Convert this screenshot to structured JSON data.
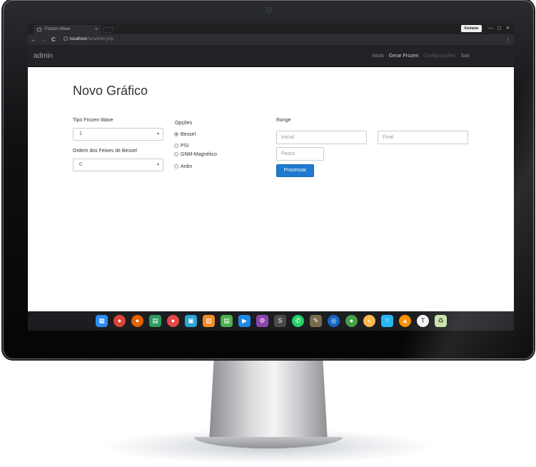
{
  "browser": {
    "tab_title": "Frozen Wave",
    "tab_close": "×",
    "visitor_label": "Visitante",
    "window_buttons": [
      "—",
      "◻",
      "✕"
    ],
    "nav_back": "←",
    "nav_forward": "→",
    "nav_reload": "C",
    "url_host": "localhost",
    "url_path": "/fw/admin.php",
    "menu": "⋮"
  },
  "navbar": {
    "brand": "admin",
    "links": [
      {
        "label": "Inicio",
        "state": "normal"
      },
      {
        "label": "Gerar Frozen",
        "state": "active"
      },
      {
        "label": "Configurações",
        "state": "disabled"
      },
      {
        "label": "Sair",
        "state": "normal"
      }
    ]
  },
  "form": {
    "title": "Novo Gráfico",
    "tipo_label": "Tipo Frozen Wave",
    "tipo_value": "1",
    "ordem_label": "Ordem dos Feixes de Bessel",
    "ordem_value": "0",
    "caret": "▼",
    "opcoes_label": "Opções",
    "options": [
      {
        "label": "Bessel",
        "checked": true
      },
      {
        "label": "PSI",
        "checked": false
      },
      {
        "label": "GNM-Magnético",
        "checked": false
      },
      {
        "label": "Anbn",
        "checked": false
      }
    ],
    "range_label": "Range",
    "inicial_placeholder": "Inicial",
    "final_placeholder": "Final",
    "passo_placeholder": "Passo",
    "submit_label": "Processar"
  },
  "dock": {
    "apps": [
      {
        "icon": "app-grid-icon",
        "color": "#2d8cf0"
      },
      {
        "icon": "chrome-icon",
        "color": "#db4437"
      },
      {
        "icon": "firefox-icon",
        "color": "#e66000"
      },
      {
        "icon": "terminal-icon",
        "color": "#2e9b5f"
      },
      {
        "icon": "record-icon",
        "color": "#e84848"
      },
      {
        "icon": "store-icon",
        "color": "#2aa6d8"
      },
      {
        "icon": "archive-icon",
        "color": "#f28c28"
      },
      {
        "icon": "file-manager-icon",
        "color": "#4caf50"
      },
      {
        "icon": "video-player-icon",
        "color": "#1e88e5"
      },
      {
        "icon": "settings-icon",
        "color": "#8e44ad"
      },
      {
        "icon": "sublime-icon",
        "color": "#4a4a4a"
      },
      {
        "icon": "whatsapp-icon",
        "color": "#25d366"
      },
      {
        "icon": "gimp-icon",
        "color": "#7a6b4f"
      },
      {
        "icon": "inkscape-icon",
        "color": "#1565c0"
      },
      {
        "icon": "android-studio-icon",
        "color": "#43a047"
      },
      {
        "icon": "scanner-icon",
        "color": "#ffb74d"
      },
      {
        "icon": "wifi-icon",
        "color": "#29b6f6"
      },
      {
        "icon": "vlc-icon",
        "color": "#ff8f00"
      },
      {
        "icon": "tex-icon",
        "color": "#f5f5f5"
      },
      {
        "icon": "trash-icon",
        "color": "#c5e1a5"
      }
    ]
  }
}
